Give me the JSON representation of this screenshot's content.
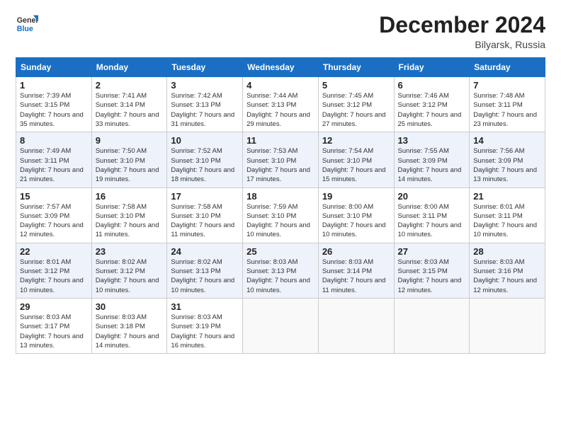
{
  "header": {
    "logo_line1": "General",
    "logo_line2": "Blue",
    "month": "December 2024",
    "location": "Bilyarsk, Russia"
  },
  "weekdays": [
    "Sunday",
    "Monday",
    "Tuesday",
    "Wednesday",
    "Thursday",
    "Friday",
    "Saturday"
  ],
  "weeks": [
    [
      {
        "day": "1",
        "sunrise": "Sunrise: 7:39 AM",
        "sunset": "Sunset: 3:15 PM",
        "daylight": "Daylight: 7 hours and 35 minutes."
      },
      {
        "day": "2",
        "sunrise": "Sunrise: 7:41 AM",
        "sunset": "Sunset: 3:14 PM",
        "daylight": "Daylight: 7 hours and 33 minutes."
      },
      {
        "day": "3",
        "sunrise": "Sunrise: 7:42 AM",
        "sunset": "Sunset: 3:13 PM",
        "daylight": "Daylight: 7 hours and 31 minutes."
      },
      {
        "day": "4",
        "sunrise": "Sunrise: 7:44 AM",
        "sunset": "Sunset: 3:13 PM",
        "daylight": "Daylight: 7 hours and 29 minutes."
      },
      {
        "day": "5",
        "sunrise": "Sunrise: 7:45 AM",
        "sunset": "Sunset: 3:12 PM",
        "daylight": "Daylight: 7 hours and 27 minutes."
      },
      {
        "day": "6",
        "sunrise": "Sunrise: 7:46 AM",
        "sunset": "Sunset: 3:12 PM",
        "daylight": "Daylight: 7 hours and 25 minutes."
      },
      {
        "day": "7",
        "sunrise": "Sunrise: 7:48 AM",
        "sunset": "Sunset: 3:11 PM",
        "daylight": "Daylight: 7 hours and 23 minutes."
      }
    ],
    [
      {
        "day": "8",
        "sunrise": "Sunrise: 7:49 AM",
        "sunset": "Sunset: 3:11 PM",
        "daylight": "Daylight: 7 hours and 21 minutes."
      },
      {
        "day": "9",
        "sunrise": "Sunrise: 7:50 AM",
        "sunset": "Sunset: 3:10 PM",
        "daylight": "Daylight: 7 hours and 19 minutes."
      },
      {
        "day": "10",
        "sunrise": "Sunrise: 7:52 AM",
        "sunset": "Sunset: 3:10 PM",
        "daylight": "Daylight: 7 hours and 18 minutes."
      },
      {
        "day": "11",
        "sunrise": "Sunrise: 7:53 AM",
        "sunset": "Sunset: 3:10 PM",
        "daylight": "Daylight: 7 hours and 17 minutes."
      },
      {
        "day": "12",
        "sunrise": "Sunrise: 7:54 AM",
        "sunset": "Sunset: 3:10 PM",
        "daylight": "Daylight: 7 hours and 15 minutes."
      },
      {
        "day": "13",
        "sunrise": "Sunrise: 7:55 AM",
        "sunset": "Sunset: 3:09 PM",
        "daylight": "Daylight: 7 hours and 14 minutes."
      },
      {
        "day": "14",
        "sunrise": "Sunrise: 7:56 AM",
        "sunset": "Sunset: 3:09 PM",
        "daylight": "Daylight: 7 hours and 13 minutes."
      }
    ],
    [
      {
        "day": "15",
        "sunrise": "Sunrise: 7:57 AM",
        "sunset": "Sunset: 3:09 PM",
        "daylight": "Daylight: 7 hours and 12 minutes."
      },
      {
        "day": "16",
        "sunrise": "Sunrise: 7:58 AM",
        "sunset": "Sunset: 3:10 PM",
        "daylight": "Daylight: 7 hours and 11 minutes."
      },
      {
        "day": "17",
        "sunrise": "Sunrise: 7:58 AM",
        "sunset": "Sunset: 3:10 PM",
        "daylight": "Daylight: 7 hours and 11 minutes."
      },
      {
        "day": "18",
        "sunrise": "Sunrise: 7:59 AM",
        "sunset": "Sunset: 3:10 PM",
        "daylight": "Daylight: 7 hours and 10 minutes."
      },
      {
        "day": "19",
        "sunrise": "Sunrise: 8:00 AM",
        "sunset": "Sunset: 3:10 PM",
        "daylight": "Daylight: 7 hours and 10 minutes."
      },
      {
        "day": "20",
        "sunrise": "Sunrise: 8:00 AM",
        "sunset": "Sunset: 3:11 PM",
        "daylight": "Daylight: 7 hours and 10 minutes."
      },
      {
        "day": "21",
        "sunrise": "Sunrise: 8:01 AM",
        "sunset": "Sunset: 3:11 PM",
        "daylight": "Daylight: 7 hours and 10 minutes."
      }
    ],
    [
      {
        "day": "22",
        "sunrise": "Sunrise: 8:01 AM",
        "sunset": "Sunset: 3:12 PM",
        "daylight": "Daylight: 7 hours and 10 minutes."
      },
      {
        "day": "23",
        "sunrise": "Sunrise: 8:02 AM",
        "sunset": "Sunset: 3:12 PM",
        "daylight": "Daylight: 7 hours and 10 minutes."
      },
      {
        "day": "24",
        "sunrise": "Sunrise: 8:02 AM",
        "sunset": "Sunset: 3:13 PM",
        "daylight": "Daylight: 7 hours and 10 minutes."
      },
      {
        "day": "25",
        "sunrise": "Sunrise: 8:03 AM",
        "sunset": "Sunset: 3:13 PM",
        "daylight": "Daylight: 7 hours and 10 minutes."
      },
      {
        "day": "26",
        "sunrise": "Sunrise: 8:03 AM",
        "sunset": "Sunset: 3:14 PM",
        "daylight": "Daylight: 7 hours and 11 minutes."
      },
      {
        "day": "27",
        "sunrise": "Sunrise: 8:03 AM",
        "sunset": "Sunset: 3:15 PM",
        "daylight": "Daylight: 7 hours and 12 minutes."
      },
      {
        "day": "28",
        "sunrise": "Sunrise: 8:03 AM",
        "sunset": "Sunset: 3:16 PM",
        "daylight": "Daylight: 7 hours and 12 minutes."
      }
    ],
    [
      {
        "day": "29",
        "sunrise": "Sunrise: 8:03 AM",
        "sunset": "Sunset: 3:17 PM",
        "daylight": "Daylight: 7 hours and 13 minutes."
      },
      {
        "day": "30",
        "sunrise": "Sunrise: 8:03 AM",
        "sunset": "Sunset: 3:18 PM",
        "daylight": "Daylight: 7 hours and 14 minutes."
      },
      {
        "day": "31",
        "sunrise": "Sunrise: 8:03 AM",
        "sunset": "Sunset: 3:19 PM",
        "daylight": "Daylight: 7 hours and 16 minutes."
      },
      null,
      null,
      null,
      null
    ]
  ]
}
